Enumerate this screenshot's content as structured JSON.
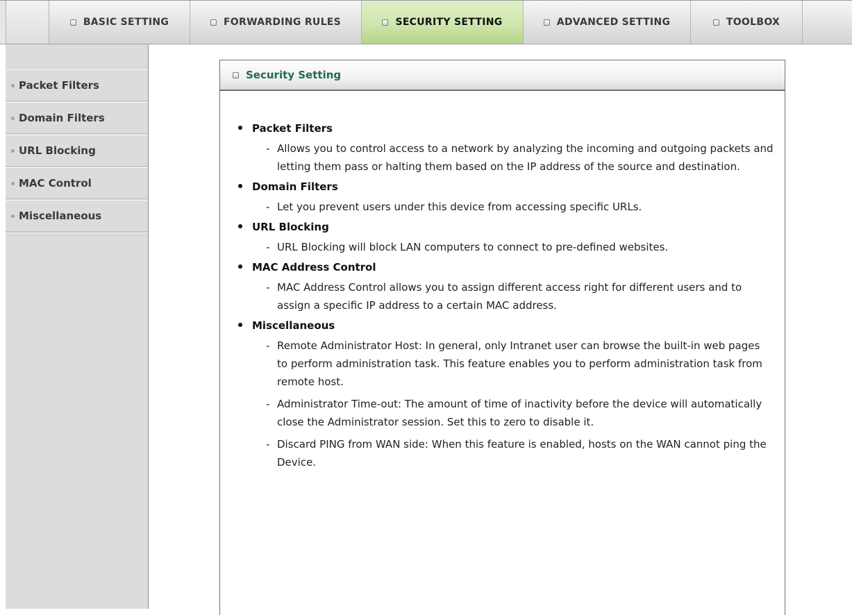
{
  "tabs": [
    {
      "label": "BASIC SETTING",
      "active": false
    },
    {
      "label": "FORWARDING RULES",
      "active": false
    },
    {
      "label": "SECURITY SETTING",
      "active": true
    },
    {
      "label": "ADVANCED SETTING",
      "active": false
    },
    {
      "label": "TOOLBOX",
      "active": false
    }
  ],
  "sidebar": {
    "items": [
      {
        "label": "Packet Filters"
      },
      {
        "label": "Domain Filters"
      },
      {
        "label": "URL Blocking"
      },
      {
        "label": "MAC Control"
      },
      {
        "label": "Miscellaneous"
      }
    ]
  },
  "panel": {
    "title": "Security Setting",
    "sections": [
      {
        "title": "Packet Filters",
        "descriptions": [
          "Allows you to control access to a network by analyzing the incoming and outgoing packets and letting them pass or halting them based on the IP address of the source and destination."
        ]
      },
      {
        "title": "Domain Filters",
        "descriptions": [
          "Let you prevent users under this device from accessing specific URLs."
        ]
      },
      {
        "title": "URL Blocking",
        "descriptions": [
          "URL Blocking will block LAN computers to connect to pre-defined websites."
        ]
      },
      {
        "title": "MAC Address Control",
        "descriptions": [
          "MAC Address Control allows you to assign different access right for different users and to assign a specific IP address to a certain MAC address."
        ]
      },
      {
        "title": "Miscellaneous",
        "descriptions": [
          "Remote Administrator Host: In general, only Intranet user can browse the built-in web pages to perform administration task. This feature enables you to perform administration task from remote host.",
          "Administrator Time-out: The amount of time of inactivity before the device will automatically close the Administrator session. Set this to zero to disable it.",
          "Discard PING from WAN side: When this feature is enabled, hosts on the WAN cannot ping the Device."
        ]
      }
    ]
  },
  "colors": {
    "active_tab": "#cfe6ad",
    "panel_title": "#1f6b52",
    "sidebar_bg": "#dcdcdc"
  },
  "icons": {
    "tab_marker": "checkbox-square-icon",
    "sidebar_marker": "bullet-dot-icon"
  }
}
